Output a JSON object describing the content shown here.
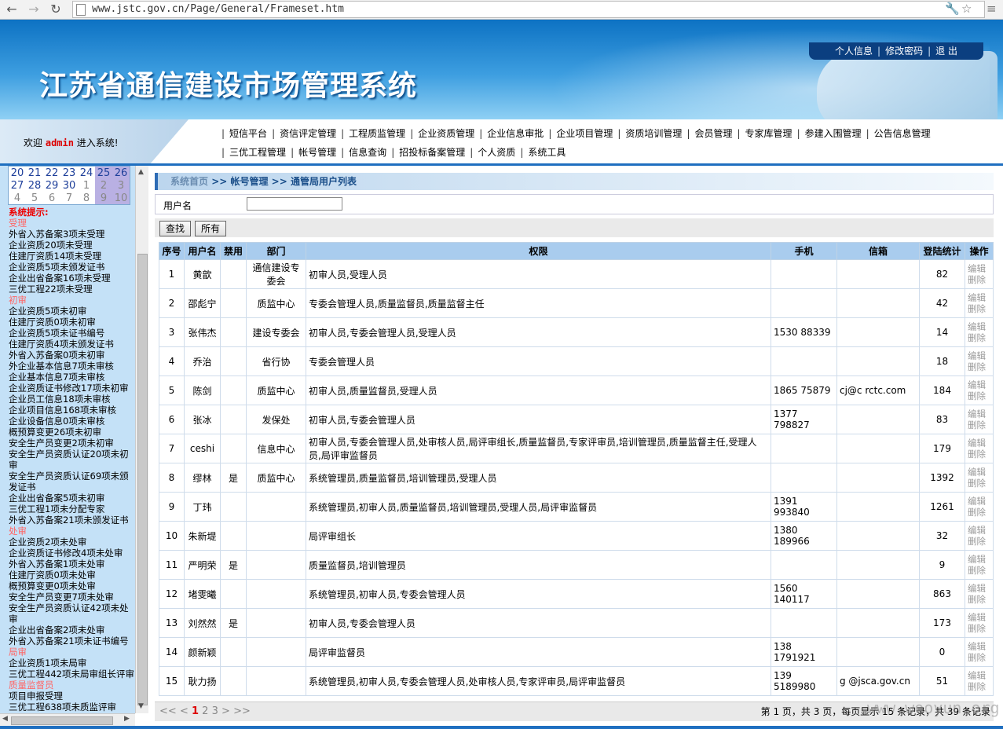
{
  "browser": {
    "url": "www.jstc.gov.cn/Page/General/Frameset.htm"
  },
  "header": {
    "title": "江苏省通信建设市场管理系统",
    "links": [
      "个人信息",
      "修改密码",
      "退 出"
    ]
  },
  "welcome": {
    "prefix": "欢迎",
    "user": "admin",
    "suffix": "进入系统!"
  },
  "menu": {
    "row1": [
      "短信平台",
      "资信评定管理",
      "工程质监管理",
      "企业资质管理",
      "企业信息审批",
      "企业项目管理",
      "资质培训管理",
      "会员管理",
      "专家库管理",
      "参建入围管理",
      "公告信息管理"
    ],
    "row2": [
      "三优工程管理",
      "帐号管理",
      "信息查询",
      "招投标备案管理",
      "个人资质",
      "系统工具"
    ]
  },
  "calendar": {
    "rows": [
      [
        {
          "d": "20",
          "t": "cur"
        },
        {
          "d": "21",
          "t": "cur"
        },
        {
          "d": "22",
          "t": "cur"
        },
        {
          "d": "23",
          "t": "cur"
        },
        {
          "d": "24",
          "t": "cur"
        },
        {
          "d": "25",
          "t": "cur hl"
        },
        {
          "d": "26",
          "t": "cur hl"
        }
      ],
      [
        {
          "d": "27",
          "t": "cur"
        },
        {
          "d": "28",
          "t": "cur"
        },
        {
          "d": "29",
          "t": "cur"
        },
        {
          "d": "30",
          "t": "cur"
        },
        {
          "d": "1",
          "t": "oth"
        },
        {
          "d": "2",
          "t": "oth hl"
        },
        {
          "d": "3",
          "t": "oth hl"
        }
      ],
      [
        {
          "d": "4",
          "t": "oth"
        },
        {
          "d": "5",
          "t": "oth"
        },
        {
          "d": "6",
          "t": "oth"
        },
        {
          "d": "7",
          "t": "oth"
        },
        {
          "d": "8",
          "t": "oth"
        },
        {
          "d": "9",
          "t": "oth hl"
        },
        {
          "d": "10",
          "t": "oth hl"
        }
      ]
    ]
  },
  "tips": {
    "heading": "系统提示:",
    "lines": [
      {
        "t": "sec",
        "v": "受理"
      },
      {
        "t": "ln",
        "v": "外省入苏备案3项未受理"
      },
      {
        "t": "ln",
        "v": "企业资质20项未受理"
      },
      {
        "t": "ln",
        "v": "住建厅资质14项未受理"
      },
      {
        "t": "ln",
        "v": "企业资质5项未颁发证书"
      },
      {
        "t": "ln",
        "v": "企业出省备案16项未受理"
      },
      {
        "t": "ln",
        "v": "三优工程22项未受理"
      },
      {
        "t": "sec",
        "v": "初审"
      },
      {
        "t": "ln",
        "v": "企业资质5项未初审"
      },
      {
        "t": "ln",
        "v": "住建厅资质0项未初审"
      },
      {
        "t": "ln",
        "v": "企业资质5项未证书编号"
      },
      {
        "t": "ln",
        "v": "住建厅资质4项未颁发证书"
      },
      {
        "t": "ln",
        "v": "外省入苏备案0项未初审"
      },
      {
        "t": "ln",
        "v": "外企业基本信息7项未审核"
      },
      {
        "t": "ln",
        "v": "企业基本信息7项未审核"
      },
      {
        "t": "ln",
        "v": "企业资质证书修改17项未初审"
      },
      {
        "t": "ln",
        "v": "企业员工信息18项未审核"
      },
      {
        "t": "ln",
        "v": "企业项目信息168项未审核"
      },
      {
        "t": "ln",
        "v": "企业设备信息0项未审核"
      },
      {
        "t": "ln",
        "v": "概预算变更26项未初审"
      },
      {
        "t": "ln",
        "v": "安全生产员变更2项未初审"
      },
      {
        "t": "ln",
        "v": "安全生产员资质认证20项未初审"
      },
      {
        "t": "ln",
        "v": "安全生产员资质认证69项未颁发证书"
      },
      {
        "t": "ln",
        "v": "企业出省备案5项未初审"
      },
      {
        "t": "ln",
        "v": "三优工程1项未分配专家"
      },
      {
        "t": "ln",
        "v": "外省入苏备案21项未颁发证书"
      },
      {
        "t": "sec",
        "v": "处审"
      },
      {
        "t": "ln",
        "v": "企业资质2项未处审"
      },
      {
        "t": "ln",
        "v": "企业资质证书修改4项未处审"
      },
      {
        "t": "ln",
        "v": "外省入苏备案1项未处审"
      },
      {
        "t": "ln",
        "v": "住建厅资质0项未处审"
      },
      {
        "t": "ln",
        "v": "概预算变更0项未处审"
      },
      {
        "t": "ln",
        "v": "安全生产员变更7项未处审"
      },
      {
        "t": "ln",
        "v": "安全生产员资质认证42项未处审"
      },
      {
        "t": "ln",
        "v": "企业出省备案2项未处审"
      },
      {
        "t": "ln",
        "v": "外省入苏备案21项未证书编号"
      },
      {
        "t": "sec",
        "v": "局审"
      },
      {
        "t": "ln",
        "v": "企业资质1项未局审"
      },
      {
        "t": "ln",
        "v": "三优工程442项未局审组长评审"
      },
      {
        "t": "sec",
        "v": "质量监督员"
      },
      {
        "t": "ln",
        "v": "项目申报受理"
      },
      {
        "t": "ln",
        "v": "三优工程638项未质监评审"
      }
    ]
  },
  "breadcrumb": {
    "home": "系统首页",
    "rest": " >> 帐号管理 >> 通管局用户列表"
  },
  "search": {
    "label": "用户名",
    "value": "",
    "find_label": "查找",
    "all_label": "所有"
  },
  "table": {
    "headers": [
      "序号",
      "用户名",
      "禁用",
      "部门",
      "权限",
      "手机",
      "信箱",
      "登陆统计",
      "操作"
    ],
    "edit_label": "编辑",
    "delete_label": "删除",
    "rows": [
      [
        "1",
        "黄歆",
        "",
        "通信建设专委会",
        "初审人员,受理人员",
        "",
        "",
        "82"
      ],
      [
        "2",
        "邵彪宁",
        "",
        "质监中心",
        "专委会管理人员,质量监督员,质量监督主任",
        "",
        "",
        "42"
      ],
      [
        "3",
        "张伟杰",
        "",
        "建设专委会",
        "初审人员,专委会管理人员,受理人员",
        "1530 88339",
        "",
        "14"
      ],
      [
        "4",
        "乔治",
        "",
        "省行协",
        "专委会管理人员",
        "",
        "",
        "18"
      ],
      [
        "5",
        "陈剑",
        "",
        "质监中心",
        "初审人员,质量监督员,受理人员",
        "1865 75879",
        "cj@c  rctc.com",
        "184"
      ],
      [
        "6",
        "张冰",
        "",
        "发保处",
        "初审人员,专委会管理人员",
        "1377 798827",
        "",
        "83"
      ],
      [
        "7",
        "ceshi",
        "",
        "信息中心",
        "初审人员,专委会管理人员,处审核人员,局评审组长,质量监督员,专家评审员,培训管理员,质量监督主任,受理人员,局评审监督员",
        "",
        "",
        "179"
      ],
      [
        "8",
        "缪林",
        "是",
        "质监中心",
        "系统管理员,质量监督员,培训管理员,受理人员",
        "",
        "",
        "1392"
      ],
      [
        "9",
        "丁玮",
        "",
        "",
        "系统管理员,初审人员,质量监督员,培训管理员,受理人员,局评审监督员",
        "1391 993840",
        "",
        "1261"
      ],
      [
        "10",
        "朱新堤",
        "",
        "",
        "局评审组长",
        "1380 189966",
        "",
        "32"
      ],
      [
        "11",
        "严明荣",
        "是",
        "",
        "质量监督员,培训管理员",
        "",
        "",
        "9"
      ],
      [
        "12",
        "堵雯曦",
        "",
        "",
        "系统管理员,初审人员,专委会管理人员",
        "1560 140117",
        "",
        "863"
      ],
      [
        "13",
        "刘然然",
        "是",
        "",
        "初审人员,专委会管理人员",
        "",
        "",
        "173"
      ],
      [
        "14",
        "颜新颖",
        "",
        "",
        "局评审监督员",
        "138 1791921",
        "",
        "0"
      ],
      [
        "15",
        "耿力扬",
        "",
        "",
        "系统管理员,初审人员,专委会管理人员,处审核人员,专家评审员,局评审监督员",
        "139 5189980",
        "g @jsca.gov.cn",
        "51"
      ]
    ]
  },
  "pager": {
    "first": "<<",
    "prev": "<",
    "pages": [
      "1",
      "2",
      "3"
    ],
    "next": ">",
    "last": ">>",
    "info": "第 1 页，共 3 页，每页显示 15 条记录，共 39 条记录"
  },
  "watermark": "www.wooyun.org"
}
